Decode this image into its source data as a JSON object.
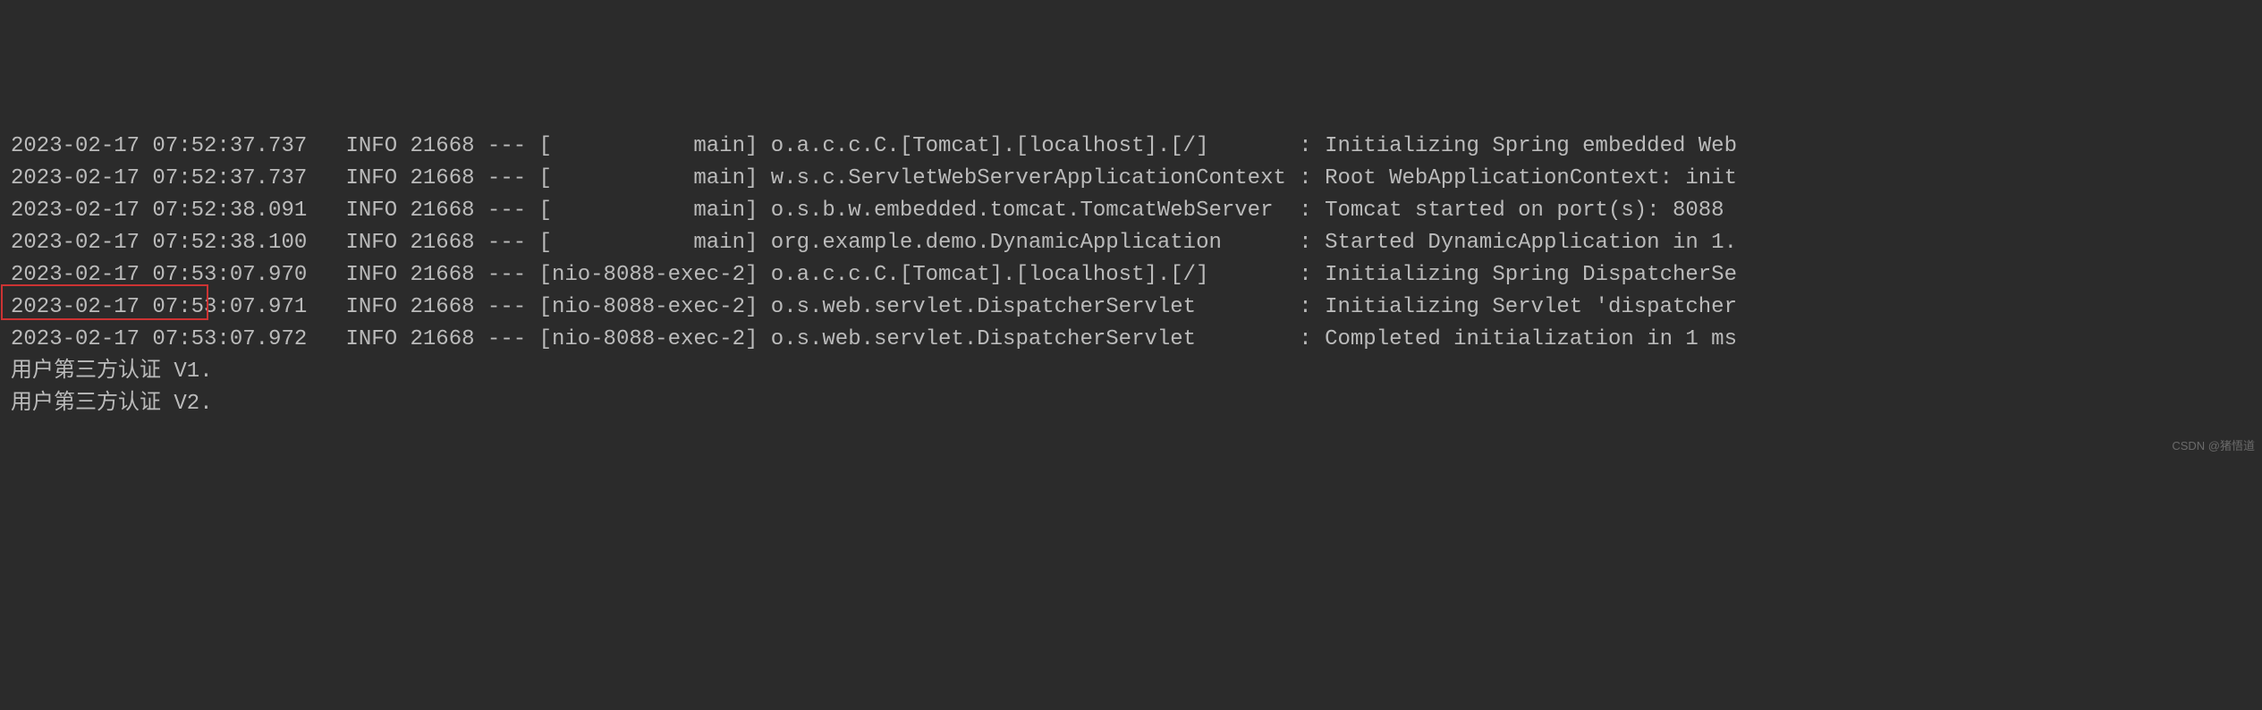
{
  "log_lines": [
    {
      "timestamp": "2023-02-17 07:52:37.737",
      "level": "INFO",
      "pid": "21668",
      "sep": "---",
      "thread": "[           main]",
      "logger": "o.a.c.c.C.[Tomcat].[localhost].[/]      ",
      "msg": ": Initializing Spring embedded Web"
    },
    {
      "timestamp": "2023-02-17 07:52:37.737",
      "level": "INFO",
      "pid": "21668",
      "sep": "---",
      "thread": "[           main]",
      "logger": "w.s.c.ServletWebServerApplicationContext",
      "msg": ": Root WebApplicationContext: init"
    },
    {
      "timestamp": "2023-02-17 07:52:38.091",
      "level": "INFO",
      "pid": "21668",
      "sep": "---",
      "thread": "[           main]",
      "logger": "o.s.b.w.embedded.tomcat.TomcatWebServer ",
      "msg": ": Tomcat started on port(s): 8088 "
    },
    {
      "timestamp": "2023-02-17 07:52:38.100",
      "level": "INFO",
      "pid": "21668",
      "sep": "---",
      "thread": "[           main]",
      "logger": "org.example.demo.DynamicApplication     ",
      "msg": ": Started DynamicApplication in 1."
    },
    {
      "timestamp": "2023-02-17 07:53:07.970",
      "level": "INFO",
      "pid": "21668",
      "sep": "---",
      "thread": "[nio-8088-exec-2]",
      "logger": "o.a.c.c.C.[Tomcat].[localhost].[/]      ",
      "msg": ": Initializing Spring DispatcherSe"
    },
    {
      "timestamp": "2023-02-17 07:53:07.971",
      "level": "INFO",
      "pid": "21668",
      "sep": "---",
      "thread": "[nio-8088-exec-2]",
      "logger": "o.s.web.servlet.DispatcherServlet       ",
      "msg": ": Initializing Servlet 'dispatcher"
    },
    {
      "timestamp": "2023-02-17 07:53:07.972",
      "level": "INFO",
      "pid": "21668",
      "sep": "---",
      "thread": "[nio-8088-exec-2]",
      "logger": "o.s.web.servlet.DispatcherServlet       ",
      "msg": ": Completed initialization in 1 ms"
    }
  ],
  "plain_lines": [
    "用户第三方认证 V1.",
    "用户第三方认证 V2."
  ],
  "watermark": "CSDN @猪悟道",
  "colors": {
    "background": "#2b2b2b",
    "text": "#bbbbbb",
    "highlight_border": "#cc3333"
  }
}
